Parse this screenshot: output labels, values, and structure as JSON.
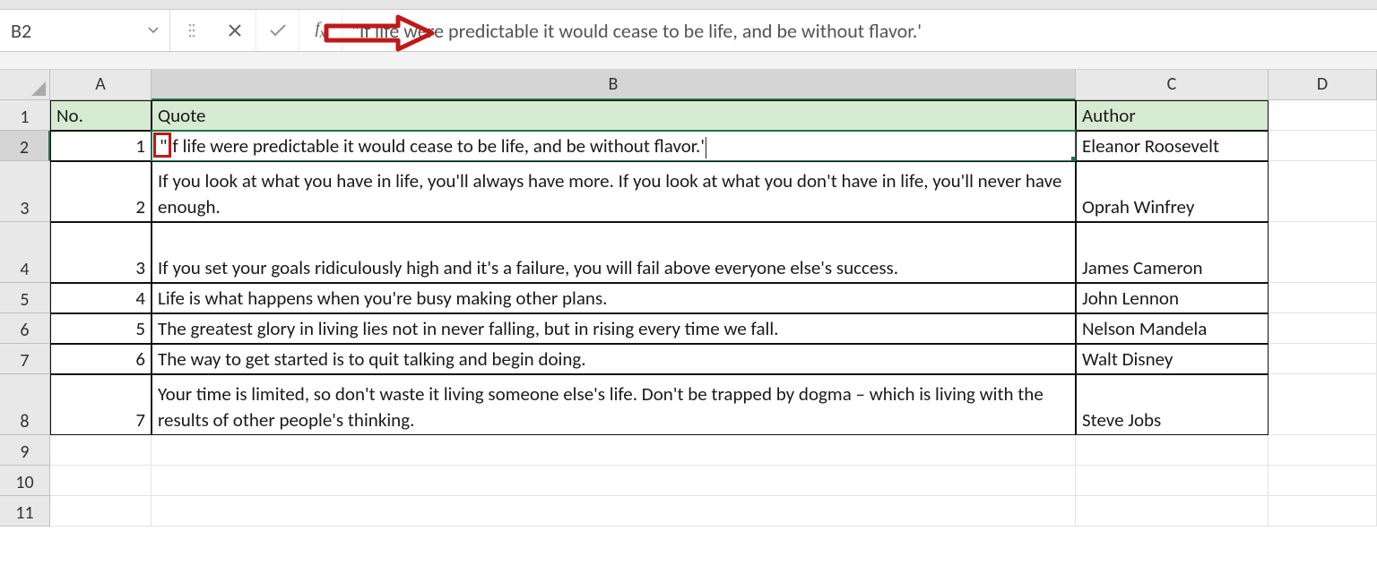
{
  "formula_bar": {
    "name_box": "B2",
    "formula": "\"If life were predictable it would cease to be life, and be without flavor.'"
  },
  "columns": [
    "A",
    "B",
    "C",
    "D"
  ],
  "active_column": "B",
  "active_row": "2",
  "headers": {
    "A": "No.",
    "B": "Quote",
    "C": "Author"
  },
  "b2_display_prefix": "\"",
  "b2_display_rest": "f life were predictable it would cease to be life, and be without flavor.'",
  "rows": [
    {
      "no": "1",
      "quote": "\"If life were predictable it would cease to be life, and be without flavor.'",
      "author": "Eleanor Roosevelt"
    },
    {
      "no": "2",
      "quote": "If you look at what you have in life, you'll always have more. If you look at what you don't have in life, you'll never have enough.",
      "author": "Oprah Winfrey"
    },
    {
      "no": "3",
      "quote": "If you set your goals ridiculously high and it's a failure, you will fail above everyone else's success.",
      "author": "James Cameron"
    },
    {
      "no": "4",
      "quote": "Life is what happens when you're busy making other plans.",
      "author": "John Lennon"
    },
    {
      "no": "5",
      "quote": "The greatest glory in living lies not in never falling, but in rising every time we fall.",
      "author": "Nelson Mandela"
    },
    {
      "no": "6",
      "quote": "The way to get started is to quit talking and begin doing.",
      "author": "Walt Disney"
    },
    {
      "no": "7",
      "quote": "Your time is limited, so don't waste it living someone else's life. Don't be trapped by dogma – which is living with the results of other people's thinking.",
      "author": "Steve Jobs"
    }
  ],
  "row_numbers": [
    "1",
    "2",
    "3",
    "4",
    "5",
    "6",
    "7",
    "8",
    "9",
    "10",
    "11"
  ]
}
